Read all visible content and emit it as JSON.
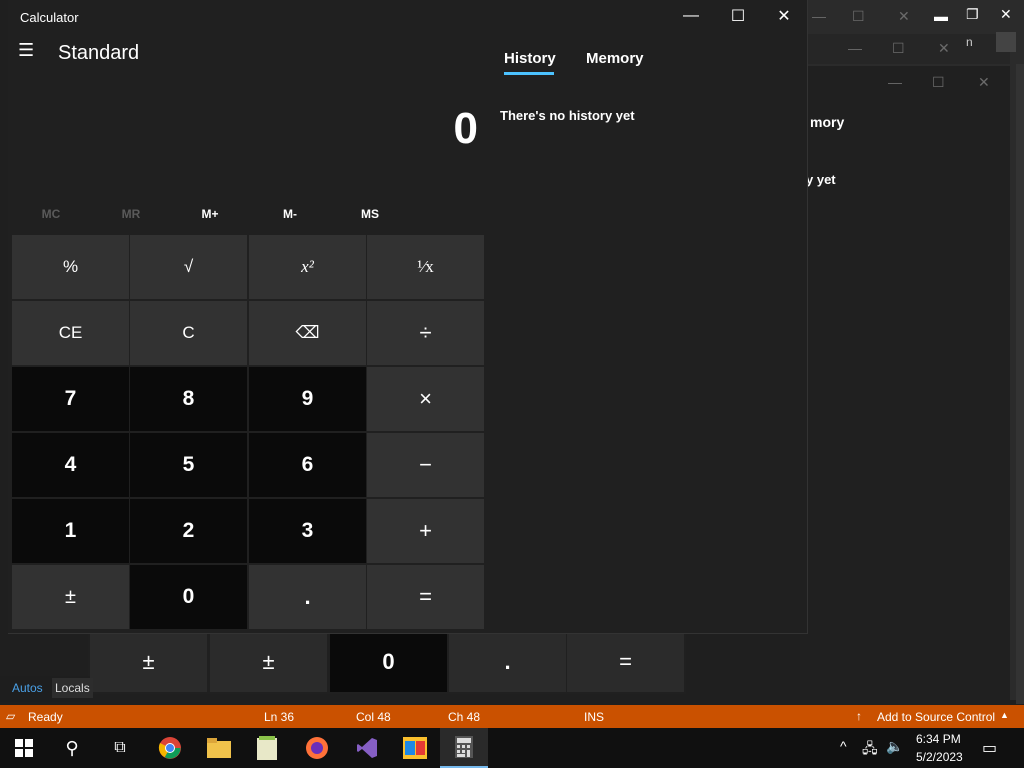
{
  "calculator": {
    "window_title": "Calculator",
    "mode_title": "Standard",
    "display_value": "0",
    "memory_buttons": [
      "MC",
      "MR",
      "M+",
      "M-",
      "MS"
    ],
    "keys": [
      [
        "%",
        "√",
        "x²",
        "¹⁄x"
      ],
      [
        "CE",
        "C",
        "⌫",
        "÷"
      ],
      [
        "7",
        "8",
        "9",
        "×"
      ],
      [
        "4",
        "5",
        "6",
        "−"
      ],
      [
        "1",
        "2",
        "3",
        "+"
      ],
      [
        "±",
        "0",
        ".",
        "="
      ]
    ],
    "tabs": [
      "History",
      "Memory"
    ],
    "history_empty": "There's no history yet"
  },
  "background": {
    "memory_partial": "mory",
    "yet_partial": "y yet",
    "n_partial": "n",
    "ghost_keys": [
      "±",
      "±",
      "0",
      ".",
      "="
    ],
    "debug_tabs": [
      "Autos",
      "Locals"
    ]
  },
  "statusbar": {
    "ready": "Ready",
    "line": "Ln 36",
    "col": "Col 48",
    "ch": "Ch 48",
    "ins": "INS",
    "source_control": "Add to Source Control"
  },
  "taskbar": {
    "time": "6:34 PM",
    "date": "5/2/2023"
  },
  "colors": {
    "accent": "#4cc2ff",
    "statusbar": "#ca5100"
  }
}
